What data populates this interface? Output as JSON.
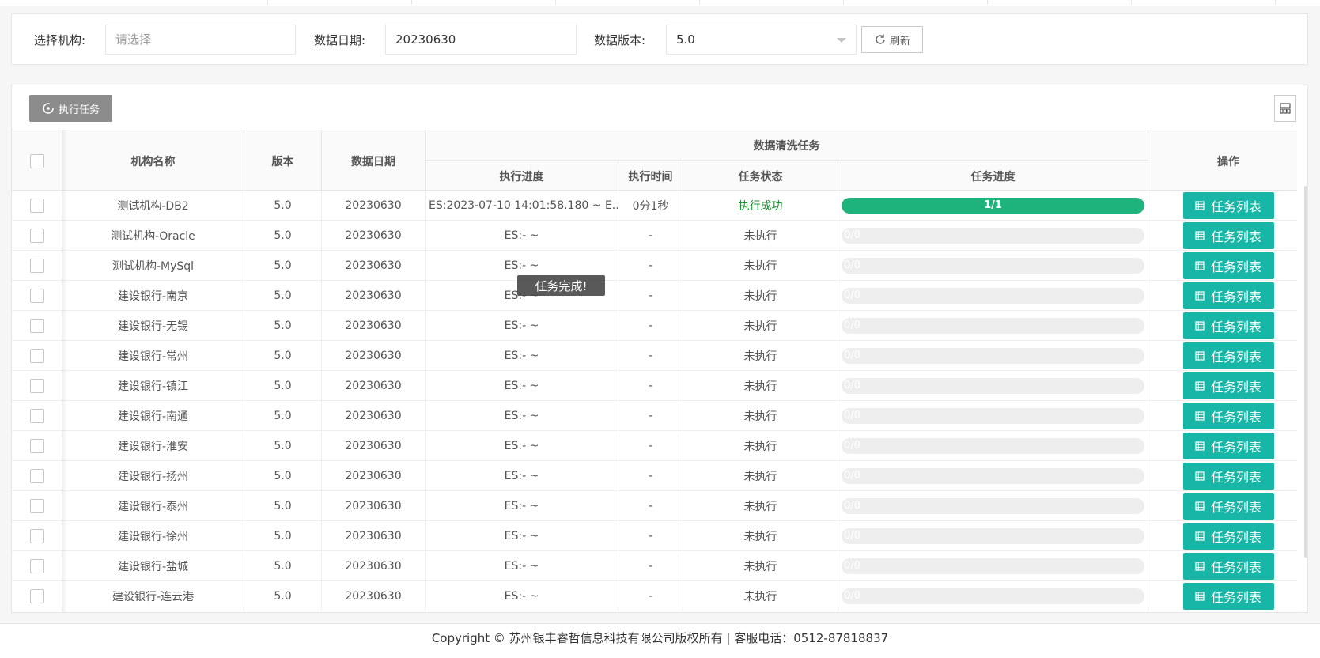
{
  "filters": {
    "org_label": "选择机构:",
    "org_placeholder": "请选择",
    "date_label": "数据日期:",
    "date_value": "20230630",
    "version_label": "数据版本:",
    "version_value": "5.0",
    "refresh_label": "刷新"
  },
  "toolbar": {
    "execute_label": "执行任务"
  },
  "table": {
    "headers": {
      "org": "机构名称",
      "version": "版本",
      "date": "数据日期",
      "group": "数据清洗任务",
      "progress_text": "执行进度",
      "exec_time": "执行时间",
      "status": "任务状态",
      "task_progress": "任务进度",
      "actions": "操作"
    },
    "action_label": "任务列表",
    "rows": [
      {
        "org": "测试机构-DB2",
        "version": "5.0",
        "date": "20230630",
        "progress_text": "ES:2023-07-10 14:01:58.180 ~ E...",
        "exec_time": "0分1秒",
        "status": "执行成功",
        "task_progress": "1/1",
        "fraction": 1
      },
      {
        "org": "测试机构-Oracle",
        "version": "5.0",
        "date": "20230630",
        "progress_text": "ES:- ~",
        "exec_time": "-",
        "status": "未执行",
        "task_progress": "0/0",
        "fraction": 0
      },
      {
        "org": "测试机构-MySql",
        "version": "5.0",
        "date": "20230630",
        "progress_text": "ES:- ~",
        "exec_time": "-",
        "status": "未执行",
        "task_progress": "0/0",
        "fraction": 0
      },
      {
        "org": "建设银行-南京",
        "version": "5.0",
        "date": "20230630",
        "progress_text": "ES:- ~",
        "exec_time": "-",
        "status": "未执行",
        "task_progress": "0/0",
        "fraction": 0
      },
      {
        "org": "建设银行-无锡",
        "version": "5.0",
        "date": "20230630",
        "progress_text": "ES:- ~",
        "exec_time": "-",
        "status": "未执行",
        "task_progress": "0/0",
        "fraction": 0
      },
      {
        "org": "建设银行-常州",
        "version": "5.0",
        "date": "20230630",
        "progress_text": "ES:- ~",
        "exec_time": "-",
        "status": "未执行",
        "task_progress": "0/0",
        "fraction": 0
      },
      {
        "org": "建设银行-镇江",
        "version": "5.0",
        "date": "20230630",
        "progress_text": "ES:- ~",
        "exec_time": "-",
        "status": "未执行",
        "task_progress": "0/0",
        "fraction": 0
      },
      {
        "org": "建设银行-南通",
        "version": "5.0",
        "date": "20230630",
        "progress_text": "ES:- ~",
        "exec_time": "-",
        "status": "未执行",
        "task_progress": "0/0",
        "fraction": 0
      },
      {
        "org": "建设银行-淮安",
        "version": "5.0",
        "date": "20230630",
        "progress_text": "ES:- ~",
        "exec_time": "-",
        "status": "未执行",
        "task_progress": "0/0",
        "fraction": 0
      },
      {
        "org": "建设银行-扬州",
        "version": "5.0",
        "date": "20230630",
        "progress_text": "ES:- ~",
        "exec_time": "-",
        "status": "未执行",
        "task_progress": "0/0",
        "fraction": 0
      },
      {
        "org": "建设银行-泰州",
        "version": "5.0",
        "date": "20230630",
        "progress_text": "ES:- ~",
        "exec_time": "-",
        "status": "未执行",
        "task_progress": "0/0",
        "fraction": 0
      },
      {
        "org": "建设银行-徐州",
        "version": "5.0",
        "date": "20230630",
        "progress_text": "ES:- ~",
        "exec_time": "-",
        "status": "未执行",
        "task_progress": "0/0",
        "fraction": 0
      },
      {
        "org": "建设银行-盐城",
        "version": "5.0",
        "date": "20230630",
        "progress_text": "ES:- ~",
        "exec_time": "-",
        "status": "未执行",
        "task_progress": "0/0",
        "fraction": 0
      },
      {
        "org": "建设银行-连云港",
        "version": "5.0",
        "date": "20230630",
        "progress_text": "ES:- ~",
        "exec_time": "-",
        "status": "未执行",
        "task_progress": "0/0",
        "fraction": 0
      }
    ]
  },
  "toast": "任务完成!",
  "footer": "Copyright © 苏州银丰睿哲信息科技有限公司版权所有 | 客服电话：0512-87818837",
  "colors": {
    "accent": "#18b6a6",
    "progress": "#1eb27d",
    "success_text": "#1a8f2f",
    "execute_button": "#8c8c8c"
  },
  "icons": {
    "refresh": "refresh-icon",
    "execute": "execute-icon",
    "columns": "columns-icon",
    "task_list": "table-icon"
  }
}
